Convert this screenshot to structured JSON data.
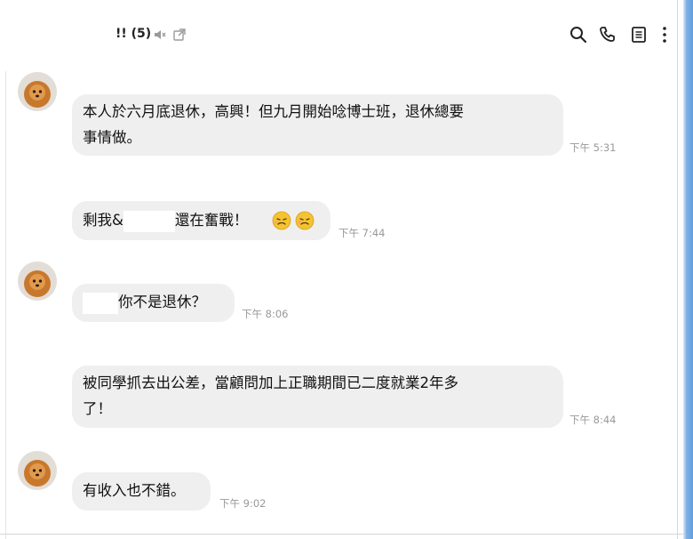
{
  "chat": {
    "title": "!!",
    "member_count": "(5)"
  },
  "messages": [
    {
      "text_line1": "本人於六月底退休，高興！但九月開始唸博士班，退休總要",
      "text_line2": "事情做。",
      "time": "下午 5:31"
    },
    {
      "text_prefix": "剩我&",
      "text_suffix": "還在奮戰！",
      "time": "下午 7:44"
    },
    {
      "text": "你不是退休？",
      "time": "下午 8:06"
    },
    {
      "text_line1": "被同學抓去出公差，當顧問加上正職期間已二度就業2年多",
      "text_line2": "了！",
      "time": "下午 8:44"
    },
    {
      "text": "有收入也不錯。",
      "time": "下午 9:02"
    }
  ],
  "icons": {
    "mute": "speaker-muted-icon",
    "popout": "popout-icon",
    "search": "search-icon",
    "call": "phone-icon",
    "notes": "notes-icon",
    "menu": "more-vertical-icon",
    "emoji": "sick-face-emoji"
  }
}
